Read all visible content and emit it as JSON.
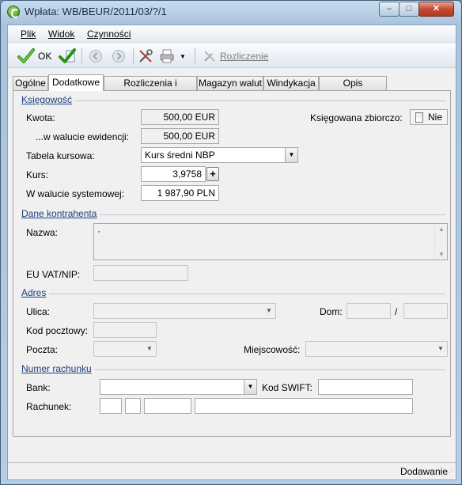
{
  "window": {
    "title": "Wpłata: WB/BEUR/2011/03/?/1",
    "minimize": "–",
    "maximize": "□",
    "close": "✕"
  },
  "menu": [
    "Plik",
    "Widok",
    "Czynności"
  ],
  "toolbar": {
    "ok_label": "OK",
    "rozliczenie_label": "Rozliczenie"
  },
  "tabs": [
    "Ogólne",
    "Dodatkowe",
    "Rozliczenia i Przelewy",
    "Magazyn walut",
    "Windykacja",
    "Opis analityczny"
  ],
  "active_tab": "Dodatkowe",
  "ksiegowosc": {
    "section": "Księgowość",
    "kwota_label": "Kwota:",
    "kwota_value": "500,00 EUR",
    "w_walucie_ewid_label": "...w walucie ewidencji:",
    "w_walucie_ewid_value": "500,00 EUR",
    "ksiegowana_zbiorczo_label": "Księgowana zbiorczo:",
    "ksiegowana_zbiorczo_value": "Nie",
    "tabela_kursowa_label": "Tabela kursowa:",
    "tabela_kursowa_value": "Kurs średni NBP",
    "kurs_label": "Kurs:",
    "kurs_value": "3,9758",
    "w_walucie_syst_label": "W walucie systemowej:",
    "w_walucie_syst_value": "1 987,90 PLN"
  },
  "kontrahent": {
    "section": "Dane kontrahenta",
    "nazwa_label": "Nazwa:",
    "nazwa_value": "·",
    "eu_vat_label": "EU VAT/NIP:",
    "eu_vat_value": ""
  },
  "adres": {
    "section": "Adres",
    "ulica_label": "Ulica:",
    "dom_label": "Dom:",
    "dom_sep": "/",
    "kod_label": "Kod pocztowy:",
    "poczta_label": "Poczta:",
    "miejscowosc_label": "Miejscowość:"
  },
  "rachunek": {
    "section": "Numer rachunku",
    "bank_label": "Bank:",
    "swift_label": "Kod SWIFT:",
    "rachunek_label": "Rachunek:"
  },
  "status": "Dodawanie"
}
